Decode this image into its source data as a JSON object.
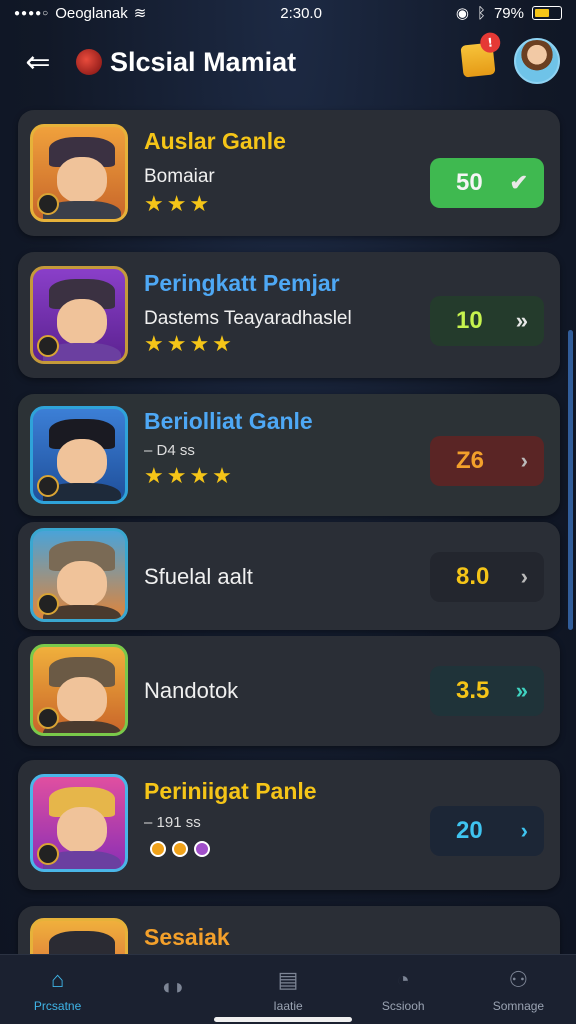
{
  "status_bar": {
    "carrier": "Oeoglanak",
    "time": "2:30.0",
    "battery": "79%"
  },
  "header": {
    "title": "Slcsial Mamiat",
    "notification_count": "!"
  },
  "items": [
    {
      "name": "Auslar Ganle",
      "name_color": "#f5c518",
      "subtitle": "Bomaiar",
      "stars": "★★★",
      "score": "50",
      "score_color": "#f5f5f5",
      "score_bg": "#3fb950",
      "chevron": "✔"
    },
    {
      "name": "Peringkatt Pemjar",
      "name_color": "#4ea8f5",
      "subtitle": "Dastems Teayaradhaslel",
      "stars": "★★★★",
      "score": "10",
      "score_color": "#c6f24e",
      "score_bg": "#243b2c",
      "chevron": "»"
    },
    {
      "name": "Beriolliat Ganle",
      "name_color": "#4ea8f5",
      "subtitle": "– D4 ss",
      "stars": "★★★★",
      "score": "Z6",
      "score_color": "#f3a02b",
      "score_bg": "#5a2525",
      "chevron": "›"
    },
    {
      "name": "",
      "name_color": "#ffffff",
      "subtitle": "Sfuelal aalt",
      "stars": "",
      "score": "8.0",
      "score_color": "#f5c518",
      "score_bg": "#23262e",
      "chevron": "›"
    },
    {
      "name": "",
      "name_color": "#ffffff",
      "subtitle": "Nandotok",
      "stars": "",
      "score": "3.5",
      "score_color": "#f5c518",
      "score_bg": "#1f3339",
      "chevron": "»"
    },
    {
      "name": "Periniigat Panle",
      "name_color": "#f5c518",
      "subtitle": "– 191 ss",
      "stars": "",
      "score": "20",
      "score_color": "#3fc4f0",
      "score_bg": "#1c2636",
      "chevron": "›"
    },
    {
      "name": "Sesaiak",
      "name_color": "#f3a02b",
      "subtitle": "",
      "stars": "",
      "score": "",
      "score_color": "#ffffff",
      "score_bg": "#2a2e36",
      "chevron": ""
    }
  ],
  "tabbar": [
    {
      "label": "Prcsatne",
      "icon": "home-icon"
    },
    {
      "label": "",
      "icon": "chat-icon"
    },
    {
      "label": "Iaatie",
      "icon": "document-icon"
    },
    {
      "label": "Scsiooh",
      "icon": "leaderboard-icon"
    },
    {
      "label": "Somnage",
      "icon": "profile-icon"
    }
  ]
}
